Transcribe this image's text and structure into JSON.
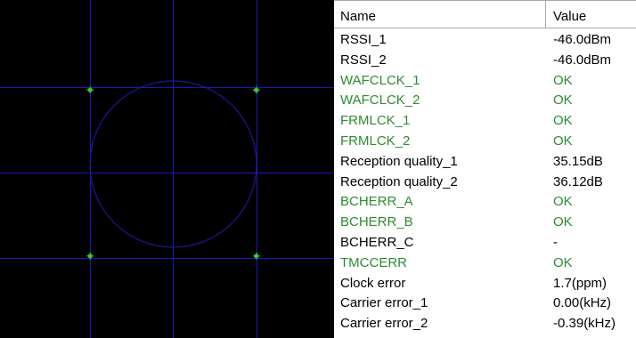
{
  "colors": {
    "plot_background": "#000000",
    "grid_line": "#1a1ab8",
    "circle": "#1a1a99",
    "point": "#33cc33",
    "ok_text": "#2e8b2e",
    "normal_text": "#000000"
  },
  "constellation": {
    "points": [
      {
        "i": 0.707,
        "q": 0.707
      },
      {
        "i": -0.707,
        "q": 0.707
      },
      {
        "i": -0.707,
        "q": -0.707
      },
      {
        "i": 0.707,
        "q": -0.707
      }
    ]
  },
  "table": {
    "headers": {
      "name": "Name",
      "value": "Value"
    },
    "rows": [
      {
        "name": "RSSI_1",
        "value": "-46.0dBm",
        "status": "normal"
      },
      {
        "name": "RSSI_2",
        "value": "-46.0dBm",
        "status": "normal"
      },
      {
        "name": "WAFCLCK_1",
        "value": "OK",
        "status": "ok"
      },
      {
        "name": "WAFCLCK_2",
        "value": "OK",
        "status": "ok"
      },
      {
        "name": "FRMLCK_1",
        "value": "OK",
        "status": "ok"
      },
      {
        "name": "FRMLCK_2",
        "value": "OK",
        "status": "ok"
      },
      {
        "name": "Reception quality_1",
        "value": "35.15dB",
        "status": "normal"
      },
      {
        "name": "Reception quality_2",
        "value": "36.12dB",
        "status": "normal"
      },
      {
        "name": "BCHERR_A",
        "value": "OK",
        "status": "ok"
      },
      {
        "name": "BCHERR_B",
        "value": "OK",
        "status": "ok"
      },
      {
        "name": "BCHERR_C",
        "value": "-",
        "status": "normal"
      },
      {
        "name": "TMCCERR",
        "value": "OK",
        "status": "ok"
      },
      {
        "name": "Clock error",
        "value": "1.7(ppm)",
        "status": "normal"
      },
      {
        "name": "Carrier error_1",
        "value": "0.00(kHz)",
        "status": "normal"
      },
      {
        "name": "Carrier error_2",
        "value": "-0.39(kHz)",
        "status": "normal"
      }
    ]
  }
}
